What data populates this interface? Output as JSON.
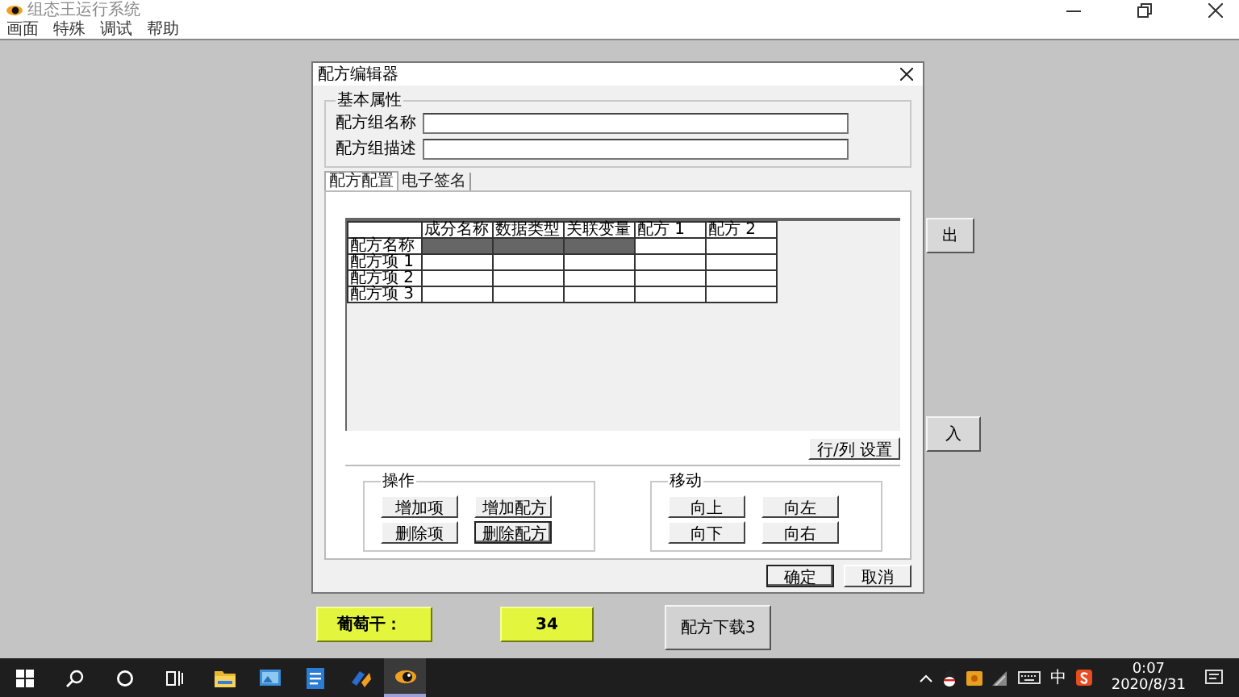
{
  "app": {
    "title": "组态王运行系统",
    "menu": [
      "画面",
      "特殊",
      "调试",
      "帮助"
    ]
  },
  "canvas_buttons": [
    {
      "label": "出",
      "kind": "gray"
    },
    {
      "label": "入",
      "kind": "gray"
    },
    {
      "label": "葡萄干：",
      "kind": "yellow"
    },
    {
      "label": "34",
      "kind": "yellow"
    },
    {
      "label": "配方下载3",
      "kind": "gray"
    }
  ],
  "dialog": {
    "title": "配方编辑器",
    "basic": {
      "title": "基本属性",
      "fields": [
        {
          "label": "配方组名称"
        },
        {
          "label": "配方组描述"
        }
      ]
    },
    "tabs": [
      {
        "label": "配方配置",
        "selected": true
      },
      {
        "label": "电子签名",
        "selected": false
      }
    ],
    "grid": {
      "columns": [
        "成分名称",
        "数据类型",
        "关联变量",
        "配方 1",
        "配方 2"
      ],
      "rows": [
        {
          "label": "配方名称",
          "cells": [
            {
              "shaded": true
            },
            {
              "shaded": true
            },
            {
              "shaded": true
            },
            {
              "shaded": false
            },
            {
              "shaded": false
            }
          ]
        },
        {
          "label": "配方项 1",
          "cells": [
            {
              "shaded": false
            },
            {
              "shaded": false
            },
            {
              "shaded": false
            },
            {
              "shaded": false
            },
            {
              "shaded": false
            }
          ]
        },
        {
          "label": "配方项 2",
          "cells": [
            {
              "shaded": false
            },
            {
              "shaded": false
            },
            {
              "shaded": false
            },
            {
              "shaded": false
            },
            {
              "shaded": false
            }
          ]
        },
        {
          "label": "配方项 3",
          "cells": [
            {
              "shaded": false
            },
            {
              "shaded": false
            },
            {
              "shaded": false
            },
            {
              "shaded": false
            },
            {
              "shaded": false
            }
          ]
        }
      ]
    },
    "settings_button": "行/列 设置",
    "groups": [
      {
        "title": "操作",
        "buttons": [
          {
            "label": "增加项",
            "focused": false
          },
          {
            "label": "增加配方",
            "focused": false
          },
          {
            "label": "删除项",
            "focused": false
          },
          {
            "label": "删除配方",
            "focused": true
          }
        ]
      },
      {
        "title": "移动",
        "buttons": [
          {
            "label": "向上",
            "focused": false
          },
          {
            "label": "向左",
            "focused": false
          },
          {
            "label": "向下",
            "focused": false
          },
          {
            "label": "向右",
            "focused": false
          }
        ]
      }
    ],
    "footer_buttons": [
      {
        "label": "确定",
        "focused": true
      },
      {
        "label": "取消",
        "focused": false
      }
    ]
  },
  "taskbar": {
    "apps": [
      {
        "kind": "folder",
        "active": false
      },
      {
        "kind": "photo",
        "active": false
      },
      {
        "kind": "document",
        "active": false
      },
      {
        "kind": "tool",
        "active": false
      },
      {
        "kind": "eye",
        "active": true
      }
    ],
    "ime": "中",
    "time": "0:07",
    "date": "2020/8/31"
  }
}
